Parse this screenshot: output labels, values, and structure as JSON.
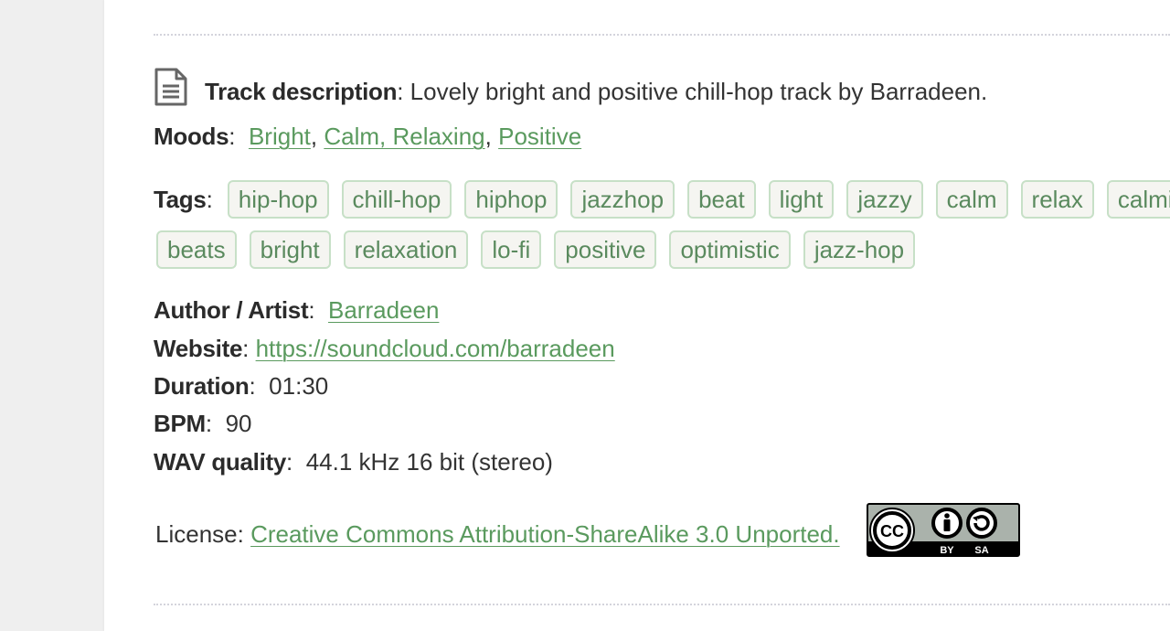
{
  "track": {
    "description_label": "Track description",
    "description_sep": ":",
    "description_text": "Lovely bright and positive chill-hop track by Barradeen.",
    "moods_label": "Moods",
    "moods": [
      "Bright",
      "Calm, Relaxing",
      "Positive"
    ],
    "tags_label": "Tags",
    "tags_row1": [
      "hip-hop",
      "chill-hop",
      "hiphop",
      "jazzhop",
      "beat",
      "light",
      "jazzy",
      "calm",
      "relax",
      "calming"
    ],
    "tags_row2": [
      "beats",
      "bright",
      "relaxation",
      "lo-fi",
      "positive",
      "optimistic",
      "jazz-hop"
    ],
    "author_label": "Author / Artist",
    "author_value": "Barradeen",
    "website_label": "Website",
    "website_value": "https://soundcloud.com/barradeen",
    "duration_label": "Duration",
    "duration_value": "01:30",
    "bpm_label": "BPM",
    "bpm_value": "90",
    "wav_label": "WAV quality",
    "wav_value": "44.1 kHz 16 bit (stereo)",
    "license_label": "License:",
    "license_value": "Creative Commons Attribution-ShareAlike 3.0 Unported.",
    "license_badge": {
      "cc": "CC",
      "by": "BY",
      "sa": "SA"
    }
  },
  "icons": {
    "description": "document-icon",
    "license": "cc-by-sa-badge"
  },
  "colors": {
    "link": "#5a9a5e",
    "tag_border": "#c7e0c7",
    "tag_bg": "#f5f5f1",
    "tag_text": "#5a8a5e"
  }
}
